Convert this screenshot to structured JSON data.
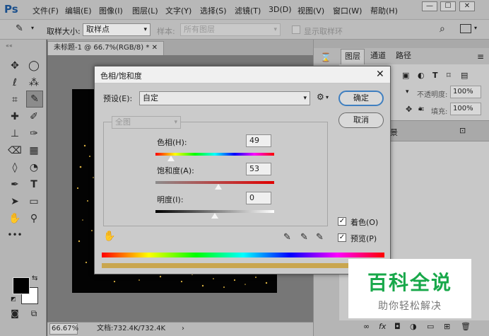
{
  "app": {
    "logo": "Ps"
  },
  "menu": [
    "文件(F)",
    "编辑(E)",
    "图像(I)",
    "图层(L)",
    "文字(Y)",
    "选择(S)",
    "滤镜(T)",
    "3D(D)",
    "视图(V)",
    "窗口(W)",
    "帮助(H)"
  ],
  "window_controls": {
    "minimize": "—",
    "maximize": "☐",
    "close": "✕"
  },
  "options": {
    "sample_size_label": "取样大小:",
    "sample_size_value": "取样点",
    "sample_label": "样本:",
    "sample_value": "所有图层",
    "show_ring_label": "显示取样环"
  },
  "document": {
    "tab_title": "未标题-1 @ 66.7%(RGB/8) *",
    "tab_close": "✕",
    "zoom": "66.67%",
    "doc_info": "文档:732.4K/732.4K"
  },
  "layers_panel": {
    "tabs": [
      "图层",
      "通道",
      "路径"
    ],
    "opacity_label": "不透明度:",
    "opacity_value": "100%",
    "fill_label": "填充:",
    "fill_value": "100%",
    "layer_name": "景"
  },
  "dialog": {
    "title": "色相/饱和度",
    "close": "✕",
    "preset_label": "预设(E):",
    "preset_value": "自定",
    "channel_value": "全图",
    "hue_label": "色相(H):",
    "hue_value": "49",
    "saturation_label": "饱和度(A):",
    "saturation_value": "53",
    "lightness_label": "明度(I):",
    "lightness_value": "0",
    "ok_label": "确定",
    "cancel_label": "取消",
    "colorize_label": "着色(O)",
    "preview_label": "预览(P)",
    "colorize_checked": true,
    "preview_checked": true,
    "hue_slider_fraction": 0.13,
    "saturation_slider_fraction": 0.53,
    "lightness_slider_fraction": 0.5
  },
  "watermark": {
    "title": "百科全说",
    "subtitle": "助你轻松解决",
    "color": "#18a84a"
  }
}
